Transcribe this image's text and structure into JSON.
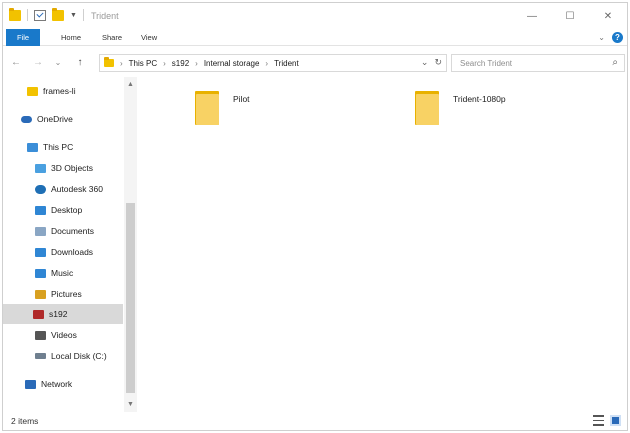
{
  "window": {
    "title": "Trident",
    "controls": {
      "minimize": "—",
      "maximize": "☐",
      "close": "✕"
    }
  },
  "ribbon": {
    "tabs": [
      "File",
      "Home",
      "Share",
      "View"
    ],
    "expand_glyph": "⌄",
    "help_glyph": "?"
  },
  "navigation": {
    "back": "←",
    "forward": "→",
    "recent": "⌄",
    "up": "↑",
    "breadcrumb": [
      "This PC",
      "s192",
      "Internal storage",
      "Trident"
    ],
    "crumb_separator": "›",
    "dropdown_glyph": "⌄",
    "refresh_glyph": "↻"
  },
  "search": {
    "placeholder": "Search Trident",
    "icon_glyph": "⌕"
  },
  "sidebar": {
    "scroll_up": "▲",
    "scroll_down": "▼",
    "items": [
      {
        "label": "frames-li",
        "icon": "folder-icon",
        "color": "#f2c200"
      },
      {
        "label": "OneDrive",
        "icon": "cloud-icon",
        "color": "#2a6ab8"
      },
      {
        "label": "This PC",
        "icon": "computer-icon",
        "color": "#3b8ed8"
      },
      {
        "label": "3D Objects",
        "icon": "3d-objects-icon",
        "color": "#4aa0e0"
      },
      {
        "label": "Autodesk 360",
        "icon": "autodesk-icon",
        "color": "#1f6fb5"
      },
      {
        "label": "Desktop",
        "icon": "desktop-icon",
        "color": "#2f86d4"
      },
      {
        "label": "Documents",
        "icon": "documents-icon",
        "color": "#8aa6c4"
      },
      {
        "label": "Downloads",
        "icon": "downloads-icon",
        "color": "#2f86d4"
      },
      {
        "label": "Music",
        "icon": "music-icon",
        "color": "#2f86d4"
      },
      {
        "label": "Pictures",
        "icon": "pictures-icon",
        "color": "#d8a020"
      },
      {
        "label": "s192",
        "icon": "device-icon",
        "color": "#b02a2a"
      },
      {
        "label": "Videos",
        "icon": "videos-icon",
        "color": "#555555"
      },
      {
        "label": "Local Disk (C:)",
        "icon": "disk-icon",
        "color": "#6f7f8f"
      },
      {
        "label": "Network",
        "icon": "network-icon",
        "color": "#2a6ab8"
      }
    ]
  },
  "files": [
    {
      "name": "Pilot",
      "icon": "folder-icon"
    },
    {
      "name": "Trident-1080p",
      "icon": "folder-icon"
    }
  ],
  "status": {
    "item_count": "2 items"
  },
  "colors": {
    "accent": "#1979ca",
    "folder": "#f8d264",
    "selection": "#d9d9d9"
  }
}
